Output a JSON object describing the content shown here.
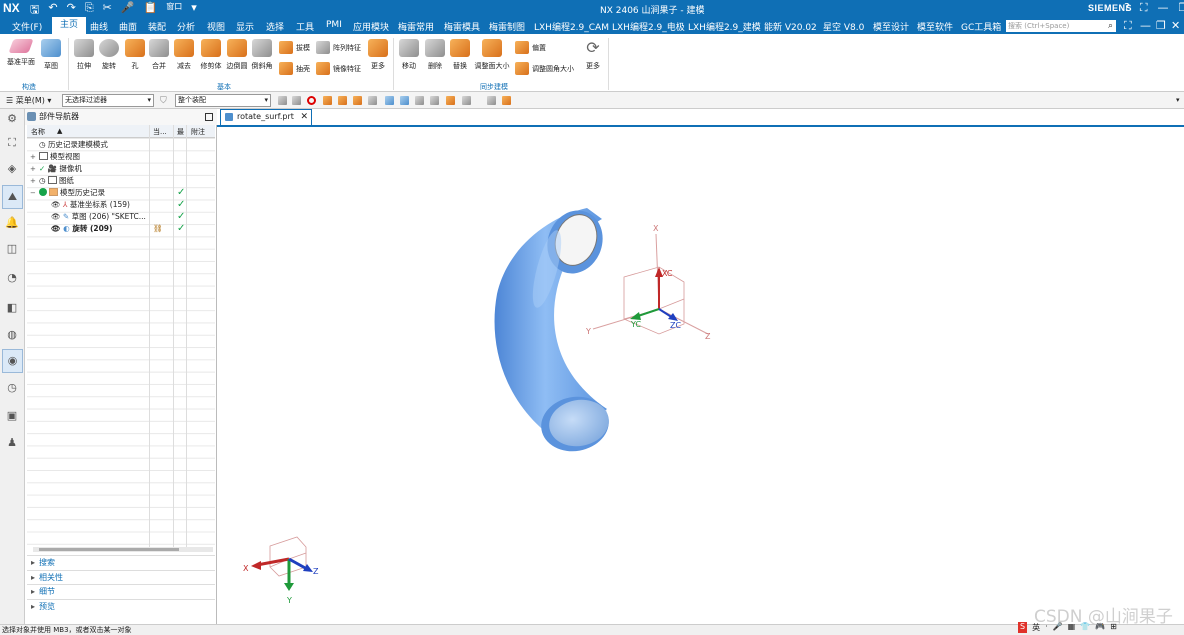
{
  "app": {
    "logo": "NX",
    "title": "NX 2406  山涧果子 - 建模",
    "brand": "SIEMENS",
    "window_controls": [
      "?",
      "⛶",
      "—",
      "❐",
      "✕"
    ]
  },
  "quick_access": [
    "🖫",
    "↶",
    "↷",
    "⎘",
    "✂",
    "🎤",
    "📋",
    "窗口",
    "▾"
  ],
  "menu": {
    "file": "文件(F)",
    "tabs": [
      "主页",
      "曲线",
      "曲面",
      "装配",
      "分析",
      "视图",
      "显示",
      "选择",
      "工具",
      "PMI",
      "应用模块",
      "梅雷常用",
      "梅雷模具",
      "梅雷制图",
      "LXH编程2.9_CAM",
      "LXH编程2.9_电极",
      "LXH编程2.9_建模",
      "能新 V20.02",
      "星空 V8.0",
      "模至设计",
      "模至软件",
      "GC工具箱"
    ],
    "active_tab": "主页",
    "search_placeholder": "搜索 (Ctrl+Space)"
  },
  "ribbon": {
    "groups": {
      "construct": "构造",
      "basic": "基本",
      "sync": "同步建模"
    },
    "buttons": {
      "datum_plane": "基准平面",
      "sketch": "草图",
      "extrude": "拉伸",
      "revolve": "旋转",
      "hole": "孔",
      "unite": "合并",
      "subtract": "减去",
      "trim_body": "修剪体",
      "edge_blend": "边倒圆",
      "chamfer": "倒斜角",
      "draft": "拔模",
      "pattern_feature": "阵列特征",
      "shell": "抽壳",
      "mirror_feature": "镜像特征",
      "more_basic": "更多",
      "move": "移动",
      "delete": "删除",
      "replace": "替换",
      "resize_face": "调整面大小",
      "offset": "偏置",
      "resize_blend": "调整圆角大小",
      "more_sync": "更多"
    }
  },
  "toolbar": {
    "menu_label": "菜单(M)",
    "filter_value": "无选择过滤器",
    "assembly_value": "整个装配"
  },
  "navigator": {
    "title": "部件导航器",
    "columns": {
      "name": "名称",
      "current": "当...",
      "latest": "最",
      "note": "附注"
    },
    "rows": [
      {
        "label": "历史记录建模模式",
        "check": ""
      },
      {
        "label": "模型视图",
        "check": ""
      },
      {
        "label": "摄像机",
        "check": ""
      },
      {
        "label": "图纸",
        "check": ""
      },
      {
        "label": "模型历史记录",
        "check": "✓"
      },
      {
        "label": "基准坐标系 (159)",
        "check": "✓"
      },
      {
        "label": "草图 (206) \"SKETC...",
        "check": "✓"
      },
      {
        "label": "旋转 (209)",
        "check": "✓"
      }
    ],
    "panels": [
      "搜索",
      "相关性",
      "细节",
      "预览"
    ]
  },
  "viewport": {
    "tab_label": "rotate_surf.prt",
    "wcs_labels": {
      "x": "X",
      "y": "Y",
      "z": "Z",
      "xc": "XC",
      "yc": "YC",
      "zc": "ZC"
    },
    "triad_labels": {
      "x": "X",
      "y": "Y",
      "z": "Z"
    }
  },
  "status": {
    "text": "选择对象并使用 MB3，或者双击某一对象"
  },
  "watermark": "CSDN @山涧果子",
  "tray": [
    "S",
    "英",
    "·",
    "🎤",
    "▦",
    "👕",
    "🎮",
    "⊞"
  ],
  "colors": {
    "accent": "#0f6fb5",
    "model": "#6fa8e8",
    "check": "#16a34a"
  }
}
